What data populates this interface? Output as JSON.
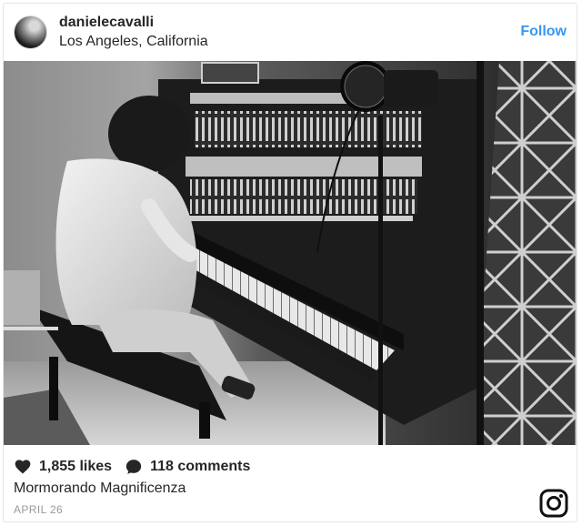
{
  "post": {
    "username": "danielecavalli",
    "location": "Los Angeles, California",
    "follow_label": "Follow",
    "likes": "1,855 likes",
    "comments": "118 comments",
    "caption": "Mormorando Magnificenza",
    "date": "APRIL 26"
  },
  "icons": {
    "like": "heart-icon",
    "comment": "comment-bubble-icon",
    "brand": "instagram-icon"
  },
  "colors": {
    "accent": "#3897f0",
    "text": "#262626",
    "muted": "#999999",
    "border": "#e6e6e6"
  }
}
